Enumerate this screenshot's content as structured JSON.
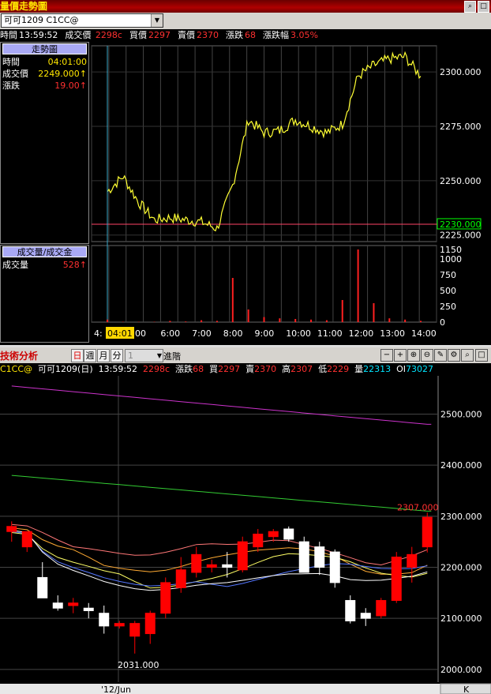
{
  "window": {
    "title": "量價走勢圖"
  },
  "toolbar": {
    "symbol_select": "可可1209    C1CC@"
  },
  "quote": {
    "time_label": "時間",
    "time": "13:59:52",
    "last_label": "成交價",
    "last": "2298c",
    "bid_label": "買價",
    "bid": "2297",
    "ask_label": "賣價",
    "ask": "2370",
    "change_label": "漲跌",
    "change": "68",
    "pct_label": "漲跌幅",
    "pct": "3.05%"
  },
  "side": {
    "header": "走勢圖",
    "rows": [
      {
        "label": "時間",
        "value": "04:01:00"
      },
      {
        "label": "成交價",
        "value": "2249.000↑"
      },
      {
        "label": "漲跌",
        "value": "19.00↑"
      }
    ],
    "vol_header": "成交量/成交金",
    "vol_label": "成交量",
    "vol_value": "528↑"
  },
  "intraday": {
    "price_ticks": [
      "2300.000",
      "2275.000",
      "2250.000",
      "2225.000"
    ],
    "ref_price": "2230.000",
    "vol_ticks": [
      "1150",
      "1000",
      "750",
      "500",
      "250",
      "0"
    ],
    "time_ticks": [
      "6:00",
      "7:00",
      "8:00",
      "9:00",
      "10:00",
      "11:00",
      "12:00",
      "13:00",
      "14:00"
    ],
    "cursor_time": "04:01",
    "left_time_fragment_a": "4:",
    "left_time_fragment_b": "00"
  },
  "tech": {
    "title": "技術分析",
    "tabs": [
      "日",
      "週",
      "月",
      "分"
    ],
    "period_select": "1",
    "advanced_label": "進階",
    "symbol": "C1CC@",
    "name": "可可1209(日)",
    "time": "13:59:52",
    "last": "2298c",
    "change_label": "漲跌",
    "change": "68",
    "bid_label": "買",
    "bid": "2297",
    "ask_label": "賣",
    "ask": "2370",
    "high_label": "高",
    "high": "2307",
    "low_label": "低",
    "low": "2229",
    "vol_label": "量",
    "vol": "22313",
    "oi_label": "OI",
    "oi": "73027",
    "price_ticks": [
      "2500.000",
      "2400.000",
      "2300.000",
      "2200.000",
      "2100.000",
      "2000.000"
    ],
    "high_mark": "2307.000",
    "low_mark": "2031.000",
    "date_label": "'12/Jun",
    "corner": "K"
  },
  "chart_data": [
    {
      "type": "line",
      "title": "",
      "xlabel": "",
      "ylabel": "",
      "ylim": [
        2222,
        2312
      ],
      "x": [
        "4:00",
        "4:30",
        "5:00",
        "5:30",
        "6:00",
        "6:30",
        "7:00",
        "7:30",
        "8:00",
        "8:30",
        "9:00",
        "9:30",
        "10:00",
        "10:30",
        "11:00",
        "11:30",
        "12:00",
        "12:30",
        "13:00",
        "13:30",
        "14:00"
      ],
      "series": [
        {
          "values": [
            2245,
            2252,
            2240,
            2232,
            2233,
            2232,
            2231,
            2228,
            2248,
            2278,
            2272,
            2273,
            2278,
            2275,
            2272,
            2276,
            2298,
            2303,
            2306,
            2307,
            2298
          ]
        }
      ],
      "reference_line": 2230
    },
    {
      "type": "bar",
      "title": "",
      "ylim": [
        0,
        1150
      ],
      "x": [
        "4:00",
        "4:30",
        "5:00",
        "5:30",
        "6:00",
        "6:30",
        "7:00",
        "7:30",
        "8:00",
        "8:30",
        "9:00",
        "9:30",
        "10:00",
        "10:30",
        "11:00",
        "11:30",
        "12:00",
        "12:30",
        "13:00",
        "13:30",
        "14:00"
      ],
      "values": [
        40,
        5,
        5,
        5,
        20,
        10,
        30,
        20,
        700,
        200,
        80,
        60,
        50,
        40,
        30,
        350,
        1150,
        300,
        60,
        40,
        20
      ]
    },
    {
      "type": "candlestick",
      "title": "",
      "ylim": [
        1975,
        2575
      ],
      "candles": [
        {
          "o": 2270,
          "h": 2290,
          "l": 2250,
          "c": 2280
        },
        {
          "o": 2240,
          "h": 2270,
          "l": 2230,
          "c": 2270
        },
        {
          "o": 2180,
          "h": 2210,
          "l": 2150,
          "c": 2140
        },
        {
          "o": 2130,
          "h": 2145,
          "l": 2115,
          "c": 2120
        },
        {
          "o": 2125,
          "h": 2140,
          "l": 2110,
          "c": 2130
        },
        {
          "o": 2120,
          "h": 2130,
          "l": 2100,
          "c": 2115
        },
        {
          "o": 2110,
          "h": 2125,
          "l": 2070,
          "c": 2085
        },
        {
          "o": 2085,
          "h": 2095,
          "l": 2080,
          "c": 2090
        },
        {
          "o": 2065,
          "h": 2095,
          "l": 2031,
          "c": 2090
        },
        {
          "o": 2070,
          "h": 2115,
          "l": 2050,
          "c": 2110
        },
        {
          "o": 2110,
          "h": 2180,
          "l": 2100,
          "c": 2170
        },
        {
          "o": 2160,
          "h": 2220,
          "l": 2150,
          "c": 2195
        },
        {
          "o": 2190,
          "h": 2240,
          "l": 2180,
          "c": 2225
        },
        {
          "o": 2200,
          "h": 2215,
          "l": 2190,
          "c": 2205
        },
        {
          "o": 2205,
          "h": 2230,
          "l": 2180,
          "c": 2200
        },
        {
          "o": 2195,
          "h": 2260,
          "l": 2190,
          "c": 2250
        },
        {
          "o": 2240,
          "h": 2275,
          "l": 2230,
          "c": 2265
        },
        {
          "o": 2260,
          "h": 2275,
          "l": 2250,
          "c": 2270
        },
        {
          "o": 2275,
          "h": 2280,
          "l": 2250,
          "c": 2255
        },
        {
          "o": 2250,
          "h": 2260,
          "l": 2190,
          "c": 2190
        },
        {
          "o": 2240,
          "h": 2250,
          "l": 2185,
          "c": 2200
        },
        {
          "o": 2230,
          "h": 2235,
          "l": 2160,
          "c": 2170
        },
        {
          "o": 2135,
          "h": 2145,
          "l": 2090,
          "c": 2095
        },
        {
          "o": 2110,
          "h": 2120,
          "l": 2085,
          "c": 2100
        },
        {
          "o": 2105,
          "h": 2140,
          "l": 2100,
          "c": 2135
        },
        {
          "o": 2135,
          "h": 2230,
          "l": 2130,
          "c": 2220
        },
        {
          "o": 2200,
          "h": 2240,
          "l": 2170,
          "c": 2225
        },
        {
          "o": 2240,
          "h": 2307,
          "l": 2229,
          "c": 2298
        }
      ],
      "moving_averages": [
        {
          "color": "#cc33cc",
          "values_start_end": [
            2555,
            2480
          ]
        },
        {
          "color": "#33cc33",
          "values_start_end": [
            2380,
            2310
          ]
        },
        {
          "color": "#ff7777",
          "values_start_end": [
            2285,
            2230
          ]
        },
        {
          "color": "#ffaa33",
          "values_start_end": [
            2275,
            2210
          ]
        },
        {
          "color": "#ffff66",
          "values_start_end": [
            2250,
            2200
          ]
        },
        {
          "color": "#5577ff",
          "values_start_end": [
            2240,
            2195
          ]
        },
        {
          "color": "#ffffff",
          "values_start_end": [
            2230,
            2205
          ]
        }
      ]
    }
  ],
  "colors": {
    "up": "#ff0000",
    "down": "#ffffff",
    "price_line": "#ffff33",
    "ref_line": "#ff4466"
  }
}
